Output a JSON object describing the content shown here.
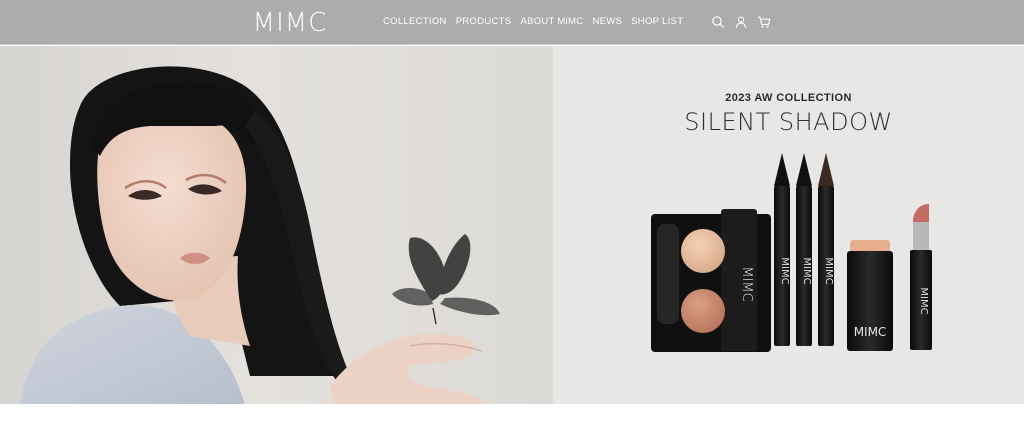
{
  "header": {
    "logo_text": "MIMC",
    "nav": [
      {
        "label": "COLLECTION"
      },
      {
        "label": "PRODUCTS"
      },
      {
        "label": "ABOUT MiMC"
      },
      {
        "label": "NEWS"
      },
      {
        "label": "SHOP LIST"
      }
    ],
    "icons": [
      "search-icon",
      "account-icon",
      "cart-icon"
    ],
    "background_color": "#acacac"
  },
  "hero": {
    "collection_subtitle": "2023 AW COLLECTION",
    "collection_title": "SILENT SHADOW",
    "product_brand_text": "MIMC",
    "right_background_color": "#e9e7e6"
  }
}
